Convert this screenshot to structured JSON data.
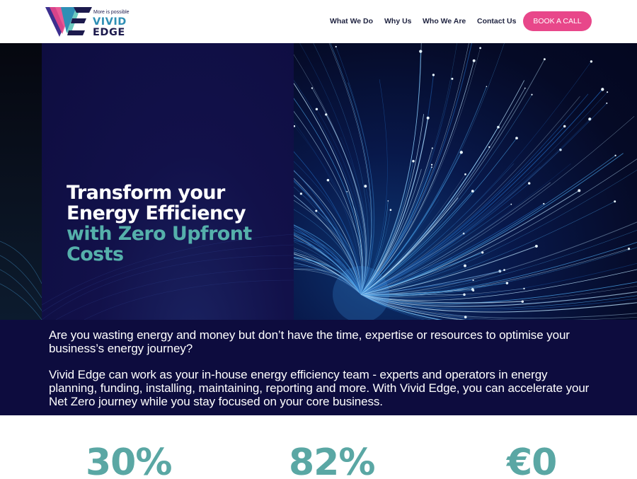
{
  "brand": {
    "tagline": "More is possible",
    "name_line1": "VIVID",
    "name_line2": "EDGE",
    "colors": {
      "navy": "#0d0c3e",
      "teal": "#55b0ab",
      "pink": "#e8478a",
      "blue": "#2f8fb5"
    }
  },
  "nav": {
    "items": [
      {
        "label": "What We Do"
      },
      {
        "label": "Why Us"
      },
      {
        "label": "Who We Are"
      },
      {
        "label": "Contact Us"
      }
    ],
    "cta_label": "BOOK A CALL"
  },
  "hero": {
    "title_line1": "Transform your",
    "title_line2": "Energy Efficiency",
    "title_line3": "with Zero Upfront",
    "title_line4": "Costs"
  },
  "intro": {
    "paragraph1": "Are you wasting energy and money but don’t have the time, expertise or resources to optimise your business’s energy journey?",
    "paragraph2": "Vivid Edge can work as your in-house energy efficiency team - experts and operators in energy planning, funding, installing, maintaining, reporting and more. With Vivid Edge, you can accelerate your Net Zero journey while you stay focused on your core business."
  },
  "stats": [
    {
      "value": "30%"
    },
    {
      "value": "82%"
    },
    {
      "value": "€0"
    }
  ]
}
